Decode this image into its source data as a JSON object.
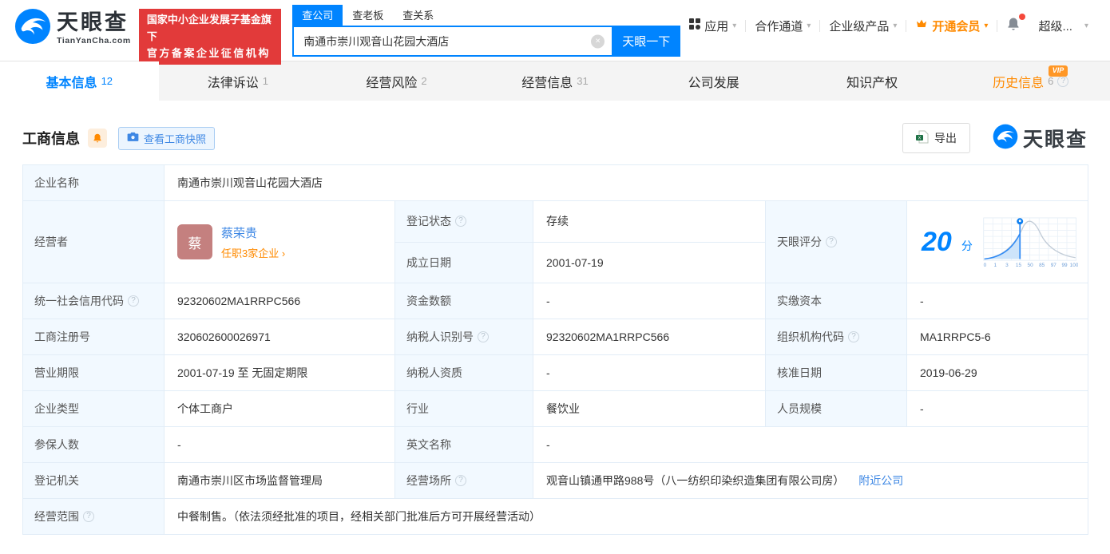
{
  "brand": {
    "name": "天眼查",
    "domain": "TianYanCha.com",
    "primary_color": "#0084ff"
  },
  "icons": {
    "help": "?",
    "clear": "×",
    "caret": "▾",
    "check_active": ""
  },
  "header": {
    "badge": {
      "line1": "国家中小企业发展子基金旗下",
      "line2": "官方备案企业征信机构",
      "bg_color": "#e23a3a"
    },
    "search_tabs": [
      {
        "label": "查公司",
        "active": true
      },
      {
        "label": "查老板",
        "active": false
      },
      {
        "label": "查关系",
        "active": false
      }
    ],
    "search": {
      "value": "南通市崇川观音山花园大酒店",
      "button_label": "天眼一下"
    },
    "nav": [
      {
        "label": "应用"
      },
      {
        "label": "合作通道"
      },
      {
        "label": "企业级产品"
      },
      {
        "label": "开通会员",
        "color": "#ff8a00"
      },
      {
        "label": "超级..."
      }
    ]
  },
  "tabs": [
    {
      "label": "基本信息",
      "count": "12",
      "active": true
    },
    {
      "label": "法律诉讼",
      "count": "1"
    },
    {
      "label": "经营风险",
      "count": "2"
    },
    {
      "label": "经营信息",
      "count": "31"
    },
    {
      "label": "公司发展"
    },
    {
      "label": "知识产权"
    },
    {
      "label": "历史信息",
      "count": "6",
      "vip_badge": "VIP",
      "color": "#ff8a00"
    }
  ],
  "section": {
    "title": "工商信息",
    "snapshot_button": "查看工商快照",
    "export_button": "导出",
    "watermark_brand": "天眼查"
  },
  "table": {
    "company_name": {
      "label": "企业名称",
      "value": "南通市崇川观音山花园大酒店"
    },
    "operator": {
      "label": "经营者",
      "avatar": "蔡",
      "name": "蔡荣贵",
      "positions_link": "任职3家企业 ›",
      "avatar_color": "#c4807f"
    },
    "reg_status": {
      "label": "登记状态",
      "value": "存续",
      "value_color": "#00ad45"
    },
    "establish_date": {
      "label": "成立日期",
      "value": "2001-07-19"
    },
    "score": {
      "label": "天眼评分",
      "value": "20",
      "unit": "分"
    },
    "credit_code": {
      "label": "统一社会信用代码",
      "value": "92320602MA1RRPC566"
    },
    "capital_amount": {
      "label": "资金数额",
      "value": "-"
    },
    "paid_capital": {
      "label": "实缴资本",
      "value": "-"
    },
    "reg_number": {
      "label": "工商注册号",
      "value": "320602600026971"
    },
    "taxpayer_id": {
      "label": "纳税人识别号",
      "value": "92320602MA1RRPC566"
    },
    "org_code": {
      "label": "组织机构代码",
      "value": "MA1RRPC5-6"
    },
    "business_term": {
      "label": "营业期限",
      "value": "2001-07-19 至 无固定期限"
    },
    "taxpayer_quality": {
      "label": "纳税人资质",
      "value": "-"
    },
    "approval_date": {
      "label": "核准日期",
      "value": "2019-06-29"
    },
    "company_type": {
      "label": "企业类型",
      "value": "个体工商户"
    },
    "industry": {
      "label": "行业",
      "value": "餐饮业"
    },
    "staff_size": {
      "label": "人员规模",
      "value": "-"
    },
    "insured_count": {
      "label": "参保人数",
      "value": "-"
    },
    "english_name": {
      "label": "英文名称",
      "value": "-"
    },
    "reg_authority": {
      "label": "登记机关",
      "value": "南通市崇川区市场监督管理局"
    },
    "business_place": {
      "label": "经营场所",
      "value": "观音山镇通甲路988号（八一纺织印染织造集团有限公司房）",
      "nearby_link": "附近公司"
    },
    "business_scope": {
      "label": "经营范围",
      "value": "中餐制售。（依法须经批准的项目，经相关部门批准后方可开展经营活动）"
    }
  },
  "chart_data": {
    "type": "area",
    "title": "天眼评分",
    "score": 20,
    "unit": "分",
    "x_ticks": [
      "0",
      "1",
      "3",
      "15",
      "50",
      "85",
      "97",
      "99",
      "100"
    ],
    "marker_position": 20,
    "curve": "normal-distribution-left-fill",
    "accent_color": "#0084ff",
    "grid": true
  }
}
